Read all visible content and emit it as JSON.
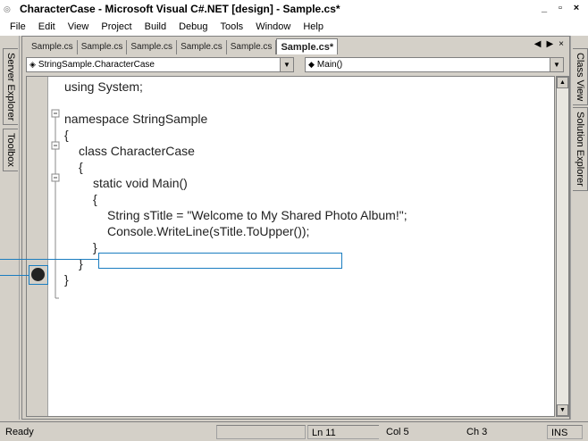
{
  "window": {
    "title": "CharacterCase - Microsoft Visual C#.NET [design] - Sample.cs*",
    "controls": [
      "_",
      "$",
      "X"
    ]
  },
  "menu": [
    "File",
    "Edit",
    "View",
    "Project",
    "Build",
    "Debug",
    "Tools",
    "Window",
    "Help"
  ],
  "left_tabs": [
    "Server Explorer",
    "Toolbox"
  ],
  "right_tabs": [
    "Class View",
    "Solution Explorer"
  ],
  "doc_tabs": [
    "Sample.cs",
    "Sample.cs",
    "Sample.cs",
    "Sample.cs",
    "Sample.cs",
    "Sample.cs*"
  ],
  "tab_nav": {
    "prev": "◀",
    "next": "▶",
    "close": "×"
  },
  "combos": {
    "type": "StringSample.CharacterCase",
    "member": "Main()"
  },
  "code_lines": [
    "using System;",
    "",
    "namespace StringSample",
    "{",
    "class CharacterCase",
    "{",
    "static void Main()",
    "{",
    "String sTitle = \"Welcome to My Shared Photo Album!\";",
    "Console.WriteLine(sTitle.ToUpper());",
    "}",
    "}",
    "}"
  ],
  "status": {
    "ready": "Ready",
    "line": "Ln 11",
    "col": "Col 5",
    "ch": "Ch 3",
    "ins": "INS"
  }
}
